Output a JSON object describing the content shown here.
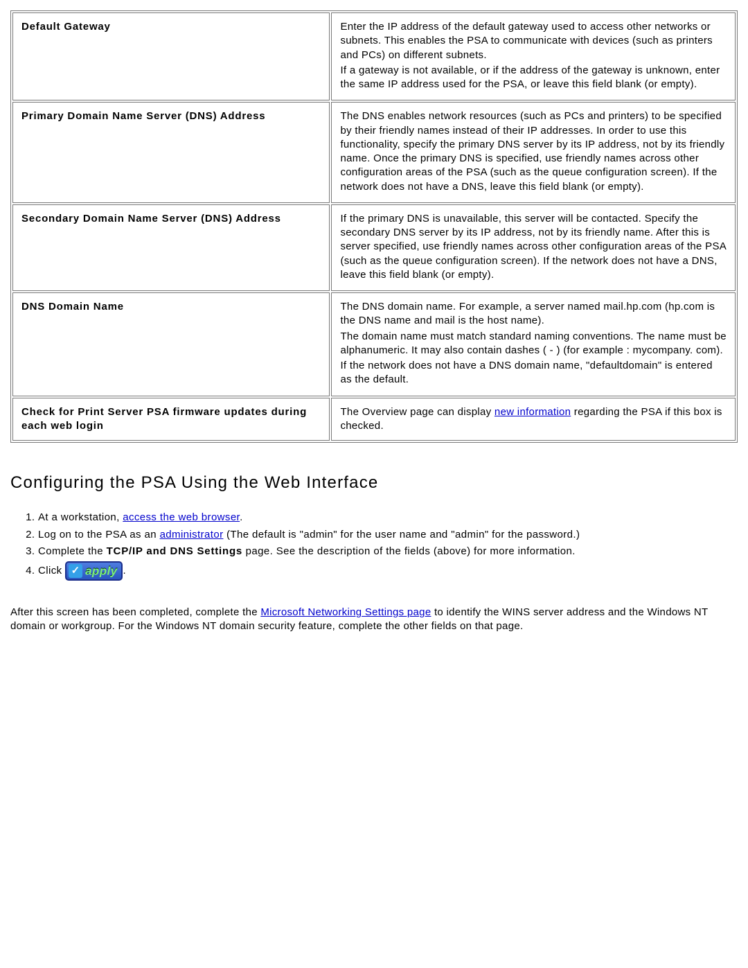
{
  "table": {
    "rows": [
      {
        "term": "Default Gateway",
        "desc": [
          "Enter the IP address of the default gateway used to access other networks or subnets. This enables the PSA to communicate with devices (such as printers and PCs) on different subnets.",
          "If a gateway is not available, or if the address of the gateway is unknown, enter the same IP address used for the PSA, or leave this field blank (or empty)."
        ]
      },
      {
        "term": "Primary Domain Name Server (DNS) Address",
        "desc": [
          "The DNS enables network resources (such as PCs and printers) to be specified by their friendly names instead of their IP addresses. In order to use this functionality, specify the primary DNS server by its IP address, not by its friendly name. Once the primary DNS is specified, use friendly names across other configuration areas of the PSA (such as the queue configuration screen). If the network does not have a DNS, leave this field blank (or empty)."
        ]
      },
      {
        "term": "Secondary Domain Name Server (DNS) Address",
        "desc": [
          "If the primary DNS is unavailable, this server will be contacted. Specify the secondary DNS server by its IP address, not by its friendly name. After this is server specified, use friendly names across other configuration areas of the PSA (such as the queue configuration screen). If the network does not have a DNS, leave this field blank (or empty)."
        ]
      },
      {
        "term": "DNS Domain Name",
        "desc": [
          "The DNS domain name. For example, a server named mail.hp.com (hp.com is the DNS name and mail is the host name).",
          "The domain name must match standard naming conventions. The name must be alphanumeric. It may also contain dashes ( - ) (for example : mycompany. com).",
          "If the network does not have a DNS domain name, \"defaultdomain\" is entered as the default."
        ]
      }
    ],
    "last_row": {
      "term": "Check for Print Server PSA firmware updates during each web login",
      "desc_before": "The Overview page can display ",
      "link": "new information",
      "desc_after": " regarding the PSA if this box is checked."
    }
  },
  "section_heading": "Configuring the PSA Using the Web Interface",
  "steps": {
    "s1_a": "At a workstation, ",
    "s1_link": "access the web browser",
    "s1_b": ".",
    "s2_a": "Log on to the PSA as an ",
    "s2_link": "administrator",
    "s2_b": " (The default is \"admin\" for the user name and \"admin\" for the password.)",
    "s3_a": "Complete the ",
    "s3_bold": "TCP/IP and DNS Settings",
    "s3_b": " page. See the description of the fields (above) for more information.",
    "s4_a": "Click ",
    "s4_btn": "apply",
    "s4_b": "."
  },
  "after": {
    "a": "After this screen has been completed, complete the ",
    "link": "Microsoft Networking Settings page",
    "b": " to identify the WINS server address and the Windows NT domain or workgroup. For the Windows NT domain security feature, complete the other fields on that page."
  }
}
